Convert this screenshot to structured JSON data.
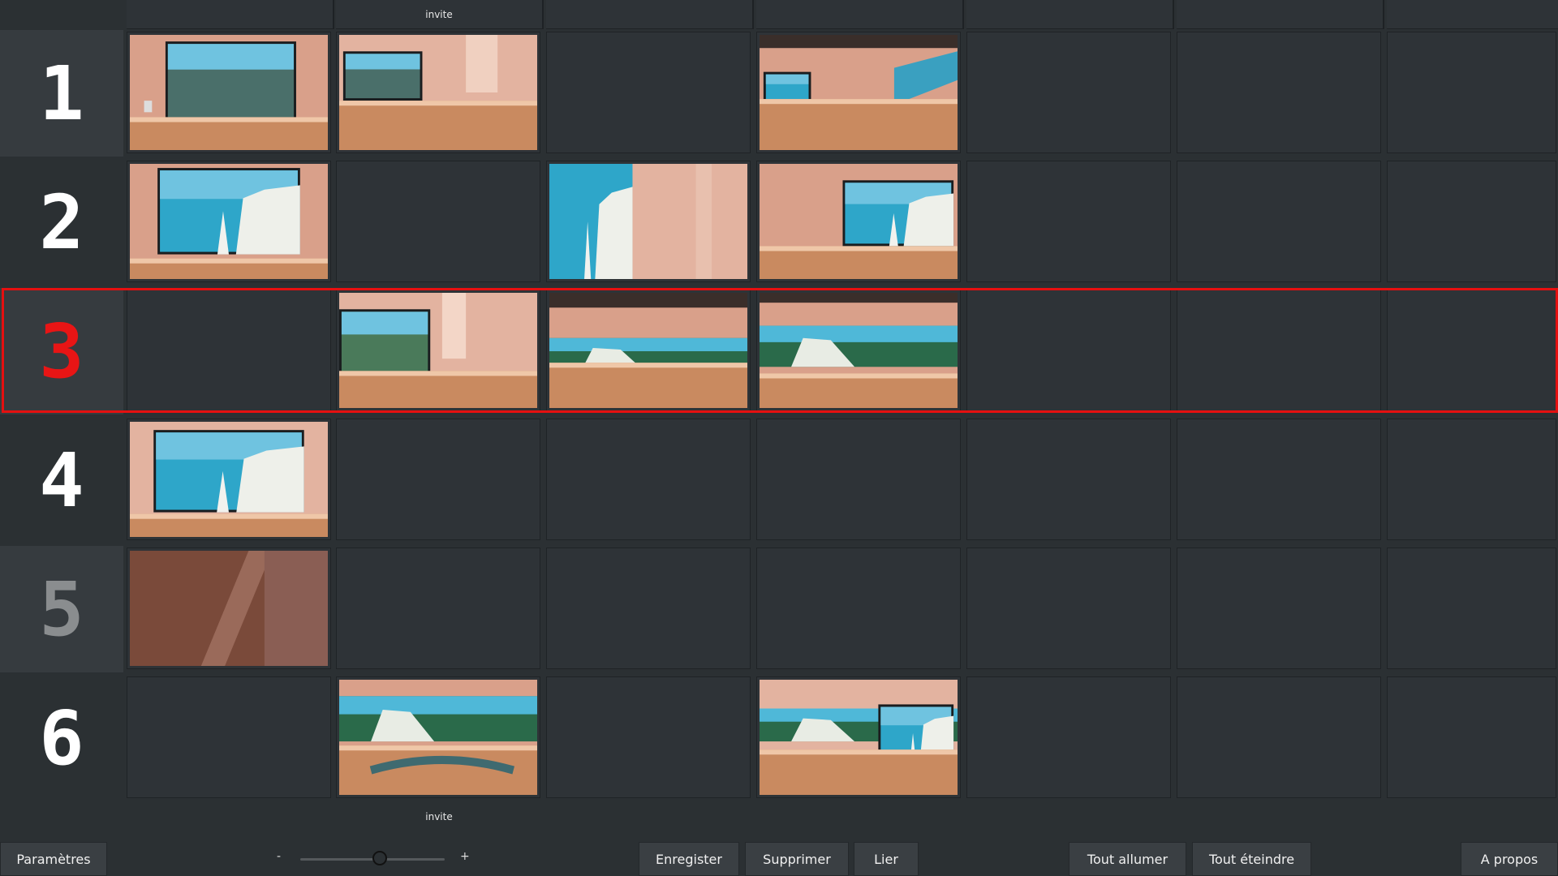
{
  "columns": [
    {
      "label": ""
    },
    {
      "label": "invite"
    },
    {
      "label": ""
    },
    {
      "label": ""
    },
    {
      "label": ""
    },
    {
      "label": ""
    },
    {
      "label": ""
    }
  ],
  "rows": [
    {
      "number": "1",
      "thumbs": [
        "studio-screen",
        "studio-desk",
        null,
        "studio-wide",
        null,
        null,
        null
      ]
    },
    {
      "number": "2",
      "thumbs": [
        "screen-arch",
        null,
        "cliff-closeup",
        "screen-desk",
        null,
        null,
        null
      ]
    },
    {
      "number": "3",
      "selected": true,
      "thumbs": [
        null,
        "desk-angle",
        "videowall-wide",
        "videowall-center",
        null,
        null,
        null
      ]
    },
    {
      "number": "4",
      "thumbs": [
        "screen-arch-bright",
        null,
        null,
        null,
        null,
        null,
        null
      ]
    },
    {
      "number": "5",
      "dim": true,
      "thumbs": [
        "closeup-wall",
        null,
        null,
        null,
        null,
        null,
        null
      ]
    },
    {
      "number": "6",
      "thumbs": [
        null,
        "videowall-desk",
        null,
        "desk-screen-right",
        null,
        null,
        null
      ]
    }
  ],
  "footer_column_label": "invite",
  "toolbar": {
    "parametres": "Paramètres",
    "zoom_minus": "-",
    "zoom_plus": "+",
    "zoom_level": 0.55,
    "enregister": "Enregister",
    "supprimer": "Supprimer",
    "lier": "Lier",
    "tout_allumer": "Tout allumer",
    "tout_eteindre": "Tout éteindre",
    "a_propos": "A propos"
  },
  "colors": {
    "background": "#2b3033",
    "cell": "#2e3337",
    "selected": "#e51010",
    "button": "#3a3f43"
  }
}
